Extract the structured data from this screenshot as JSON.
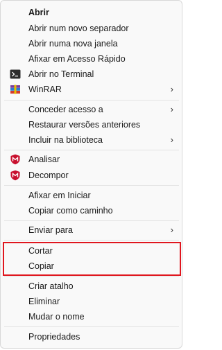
{
  "menu": {
    "items": [
      {
        "label": "Abrir"
      },
      {
        "label": "Abrir num novo separador"
      },
      {
        "label": "Abrir numa nova janela"
      },
      {
        "label": "Afixar em Acesso Rápido"
      },
      {
        "label": "Abrir no Terminal",
        "icon": "terminal-icon"
      },
      {
        "label": "WinRAR",
        "icon": "winrar-icon",
        "submenu": "›"
      },
      {
        "label": "Conceder acesso a",
        "submenu": "›"
      },
      {
        "label": "Restaurar versões anteriores"
      },
      {
        "label": "Incluir na biblioteca",
        "submenu": "›"
      },
      {
        "label": "Analisar",
        "icon": "mcafee-shield-icon"
      },
      {
        "label": "Decompor",
        "icon": "mcafee-shield-icon"
      },
      {
        "label": "Afixar em Iniciar"
      },
      {
        "label": "Copiar como caminho"
      },
      {
        "label": "Enviar para",
        "submenu": "›"
      },
      {
        "label": "Cortar"
      },
      {
        "label": "Copiar"
      },
      {
        "label": "Criar atalho"
      },
      {
        "label": "Eliminar"
      },
      {
        "label": "Mudar o nome"
      },
      {
        "label": "Propriedades"
      }
    ],
    "highlight_color": "#e0161e",
    "mcafee_color": "#c8102e"
  }
}
